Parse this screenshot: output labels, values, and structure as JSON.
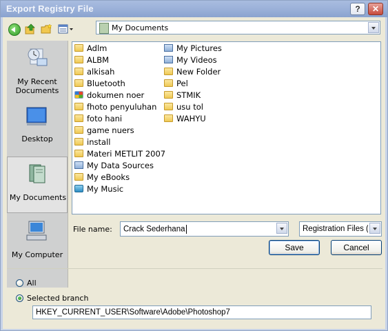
{
  "window": {
    "title": "Export Registry File",
    "help_label": "?",
    "close_label": "✕"
  },
  "lookin": {
    "value": "My Documents"
  },
  "places": [
    {
      "label": "My Recent Documents",
      "icon": "recent-documents-icon"
    },
    {
      "label": "Desktop",
      "icon": "desktop-icon"
    },
    {
      "label": "My Documents",
      "icon": "my-documents-icon",
      "selected": true
    },
    {
      "label": "My Computer",
      "icon": "my-computer-icon"
    }
  ],
  "files": {
    "col1": [
      {
        "name": "Adlm",
        "icon": "folder"
      },
      {
        "name": "ALBM",
        "icon": "folder"
      },
      {
        "name": "alkisah",
        "icon": "folder"
      },
      {
        "name": "Bluetooth",
        "icon": "folder"
      },
      {
        "name": "dokumen noer",
        "icon": "windows"
      },
      {
        "name": "fhoto penyuluhan",
        "icon": "folder"
      },
      {
        "name": "foto hani",
        "icon": "folder"
      },
      {
        "name": "game nuers",
        "icon": "folder"
      },
      {
        "name": "install",
        "icon": "folder"
      },
      {
        "name": "Materi METLIT 2007",
        "icon": "folder"
      },
      {
        "name": "My Data Sources",
        "icon": "special"
      },
      {
        "name": "My eBooks",
        "icon": "folder"
      },
      {
        "name": "My Music",
        "icon": "music"
      }
    ],
    "col2": [
      {
        "name": "My Pictures",
        "icon": "special"
      },
      {
        "name": "My Videos",
        "icon": "special"
      },
      {
        "name": "New Folder",
        "icon": "folder"
      },
      {
        "name": "Pel",
        "icon": "folder"
      },
      {
        "name": "STMIK",
        "icon": "folder"
      },
      {
        "name": "usu tol",
        "icon": "folder"
      },
      {
        "name": "WAHYU",
        "icon": "folder"
      }
    ]
  },
  "filename": {
    "label": "File name:",
    "value": "Crack Sederhana"
  },
  "filetype": {
    "value": "Registration Files (*.reg)"
  },
  "buttons": {
    "save": "Save",
    "cancel": "Cancel"
  },
  "range": {
    "all_label": "All",
    "selected_label": "Selected branch",
    "selected": "selected_branch",
    "branch_value": "HKEY_CURRENT_USER\\Software\\Adobe\\Photoshop7"
  }
}
